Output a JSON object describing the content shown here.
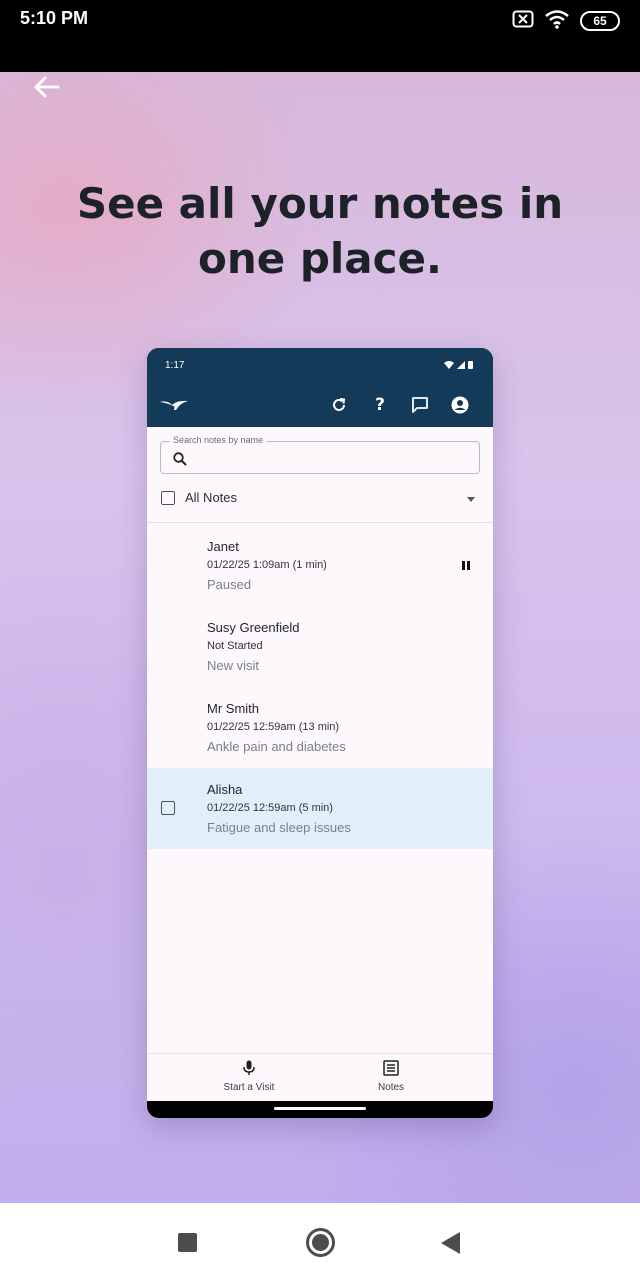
{
  "status_bar": {
    "time": "5:10 PM",
    "battery": "65",
    "icons": [
      "sim-off-icon",
      "wifi-icon",
      "battery-icon"
    ]
  },
  "page": {
    "back_icon": "arrow-left-icon",
    "headline": "See all your notes in one place."
  },
  "phone": {
    "status_time": "1:17",
    "toolbar_icons": [
      "logo-icon",
      "refresh-icon",
      "help-icon",
      "feedback-icon",
      "account-icon"
    ],
    "search": {
      "label": "Search notes by name",
      "value": ""
    },
    "filter": {
      "label": "All Notes"
    },
    "notes": [
      {
        "name": "Janet",
        "meta": "01/22/25 1:09am (1 min)",
        "description": "Paused",
        "status_icon": "pause-icon",
        "selected": false
      },
      {
        "name": "Susy Greenfield",
        "meta": "Not Started",
        "description": "New visit",
        "selected": false
      },
      {
        "name": "Mr Smith",
        "meta": "01/22/25 12:59am (13 min)",
        "description": "Ankle pain and diabetes",
        "selected": false
      },
      {
        "name": "Alisha",
        "meta": "01/22/25 12:59am (5 min)",
        "description": "Fatigue and sleep issues",
        "selected": true
      }
    ],
    "bottom_nav": [
      {
        "label": "Start a Visit",
        "icon": "microphone-icon"
      },
      {
        "label": "Notes",
        "icon": "notes-list-icon"
      }
    ]
  },
  "colors": {
    "toolbar": "#133a58",
    "selected_row": "#e0effa"
  },
  "android_nav": [
    "recents-button",
    "home-button",
    "back-button"
  ]
}
